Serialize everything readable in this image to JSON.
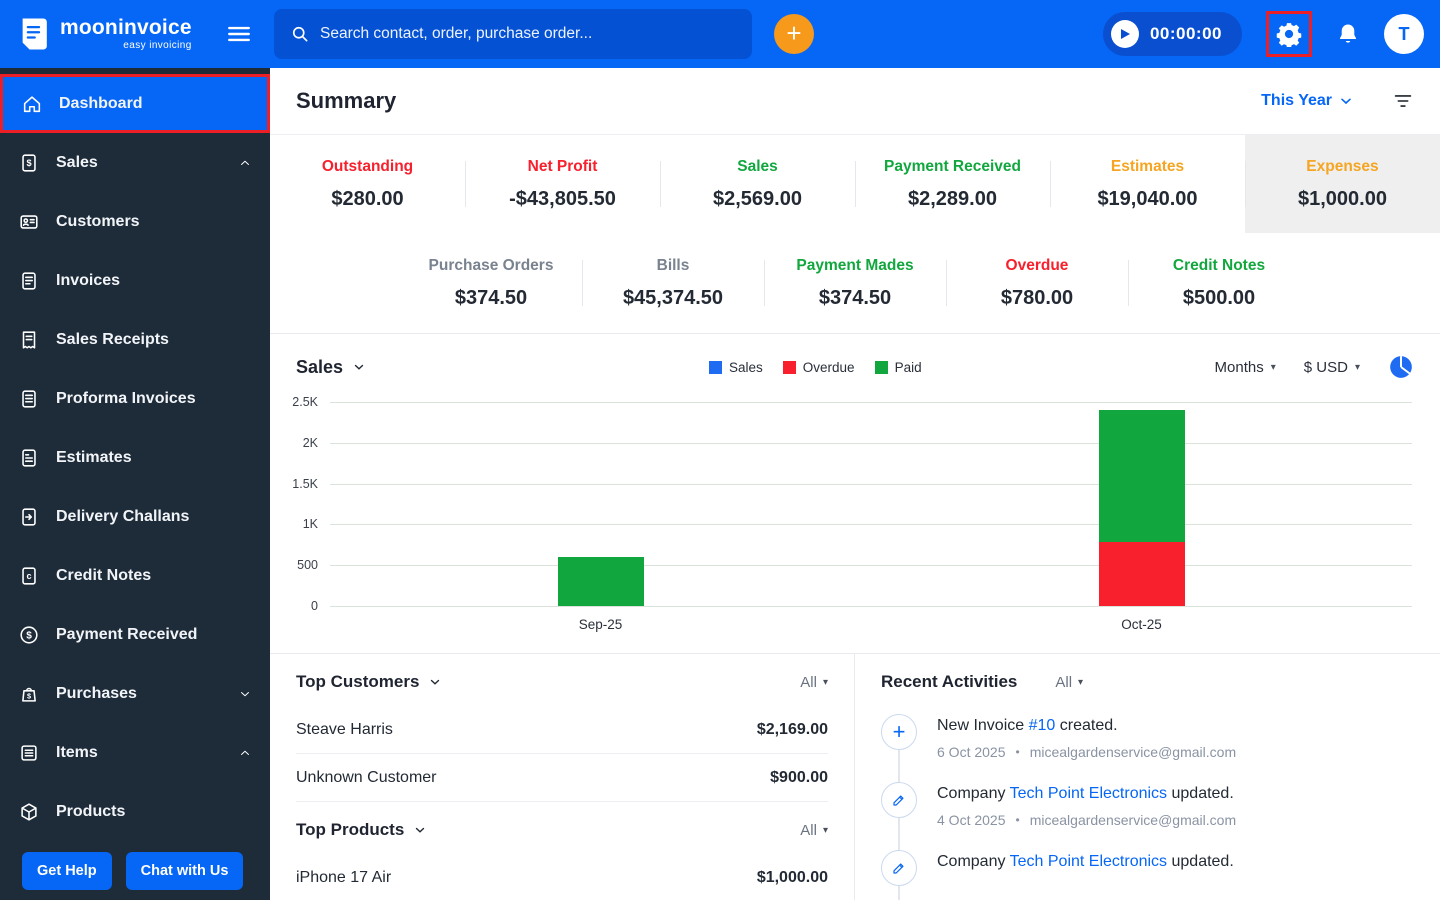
{
  "topbar": {
    "brand_name": "mooninvoice",
    "brand_tagline": "easy invoicing",
    "search_placeholder": "Search contact, order, purchase order...",
    "timer": "00:00:00",
    "avatar_initial": "T"
  },
  "sidebar": {
    "items": [
      {
        "label": "Dashboard",
        "icon": "home-icon",
        "active": true
      },
      {
        "label": "Sales",
        "icon": "sales-icon",
        "chevron": "up"
      },
      {
        "label": "Customers",
        "icon": "customers-icon"
      },
      {
        "label": "Invoices",
        "icon": "invoice-icon"
      },
      {
        "label": "Sales Receipts",
        "icon": "receipt-icon"
      },
      {
        "label": "Proforma Invoices",
        "icon": "proforma-icon"
      },
      {
        "label": "Estimates",
        "icon": "estimate-icon"
      },
      {
        "label": "Delivery Challans",
        "icon": "delivery-icon"
      },
      {
        "label": "Credit Notes",
        "icon": "credit-note-icon"
      },
      {
        "label": "Payment Received",
        "icon": "payment-received-icon"
      },
      {
        "label": "Purchases",
        "icon": "purchases-icon",
        "chevron": "down"
      },
      {
        "label": "Items",
        "icon": "items-icon",
        "chevron": "up"
      },
      {
        "label": "Products",
        "icon": "products-icon"
      }
    ],
    "get_help_label": "Get Help",
    "chat_label": "Chat with Us"
  },
  "summary": {
    "title": "Summary",
    "period_label": "This Year",
    "row1": [
      {
        "label": "Outstanding",
        "value": "$280.00",
        "tone": "red"
      },
      {
        "label": "Net Profit",
        "value": "-$43,805.50",
        "tone": "red"
      },
      {
        "label": "Sales",
        "value": "$2,569.00",
        "tone": "green"
      },
      {
        "label": "Payment Received",
        "value": "$2,289.00",
        "tone": "green"
      },
      {
        "label": "Estimates",
        "value": "$19,040.00",
        "tone": "orange"
      },
      {
        "label": "Expenses",
        "value": "$1,000.00",
        "tone": "orange",
        "highlighted": true
      }
    ],
    "row2": [
      {
        "label": "Purchase Orders",
        "value": "$374.50",
        "tone": "gray"
      },
      {
        "label": "Bills",
        "value": "$45,374.50",
        "tone": "gray"
      },
      {
        "label": "Payment Mades",
        "value": "$374.50",
        "tone": "green"
      },
      {
        "label": "Overdue",
        "value": "$780.00",
        "tone": "red"
      },
      {
        "label": "Credit Notes",
        "value": "$500.00",
        "tone": "green"
      }
    ]
  },
  "chart_header": {
    "title": "Sales",
    "months_label": "Months",
    "currency_label": "$ USD"
  },
  "chart_data": {
    "type": "bar",
    "stacked": true,
    "title": "Sales",
    "x": [
      "Sep-25",
      "Oct-25"
    ],
    "series": [
      {
        "name": "Sales",
        "color": "#1F6BF2",
        "values": [
          0,
          0
        ]
      },
      {
        "name": "Overdue",
        "color": "#F7202C",
        "values": [
          0,
          780
        ]
      },
      {
        "name": "Paid",
        "color": "#12A73E",
        "values": [
          600,
          1620
        ]
      }
    ],
    "ylim": [
      0,
      2500
    ],
    "y_ticks": [
      0,
      500,
      1000,
      1500,
      2000,
      2500
    ],
    "y_tick_labels": [
      "0",
      "500",
      "1K",
      "1.5K",
      "2K",
      "2.5K"
    ],
    "legend": [
      "Sales",
      "Overdue",
      "Paid"
    ],
    "legend_position": "top-center",
    "grid": true,
    "currency": "USD",
    "period": "Months"
  },
  "top_customers": {
    "title": "Top Customers",
    "filter": "All",
    "rows": [
      {
        "name": "Steave Harris",
        "amount": "$2,169.00"
      },
      {
        "name": "Unknown Customer",
        "amount": "$900.00"
      }
    ]
  },
  "top_products": {
    "title": "Top Products",
    "filter": "All",
    "rows": [
      {
        "name": "iPhone 17 Air",
        "amount": "$1,000.00"
      }
    ]
  },
  "recent_activities": {
    "title": "Recent Activities",
    "filter": "All",
    "items": [
      {
        "icon": "plus-icon",
        "prefix": "New Invoice ",
        "link": "#10",
        "suffix": " created.",
        "date": "6 Oct 2025",
        "email": "micealgardenservice@gmail.com"
      },
      {
        "icon": "pencil-icon",
        "prefix": "Company ",
        "link": "Tech Point Electronics",
        "suffix": " updated.",
        "date": "4 Oct 2025",
        "email": "micealgardenservice@gmail.com"
      },
      {
        "icon": "pencil-icon",
        "prefix": "Company ",
        "link": "Tech Point Electronics",
        "suffix": " updated.",
        "date": "",
        "email": ""
      }
    ]
  },
  "colors": {
    "topbar_blue": "#0666F5",
    "search_blue": "#0551D4",
    "sidebar_navy": "#1E2B39",
    "accent_orange": "#F79A1B",
    "red": "#F7202C",
    "green": "#12A73E",
    "label_orange": "#F5A522",
    "annotation_red": "#EC1F26",
    "link_blue": "#0666F5",
    "highlight_gray": "#EFEFEF"
  }
}
